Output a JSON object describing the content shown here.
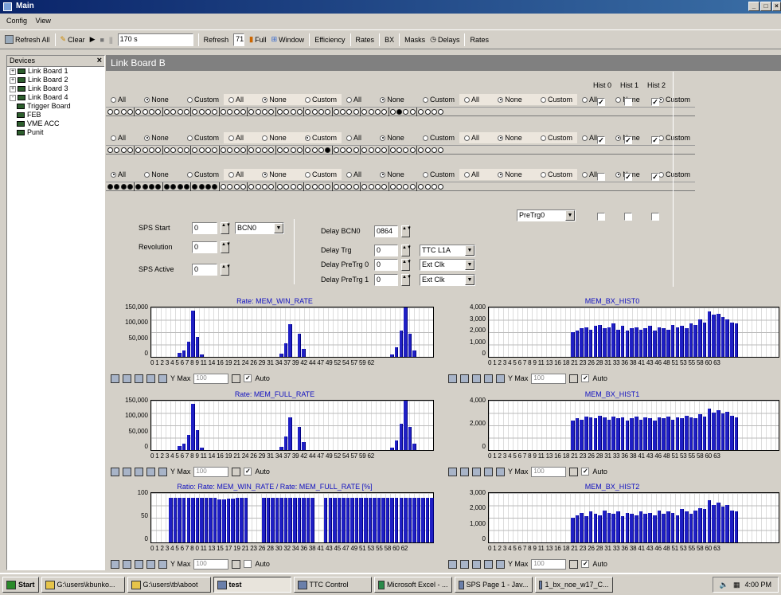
{
  "window": {
    "title": "Main",
    "controls": [
      "_",
      "□",
      "×"
    ]
  },
  "menu": [
    "Config",
    "View"
  ],
  "toolbar": {
    "refresh_all": "Refresh All",
    "clear": "Clear",
    "play": "▶",
    "stop": "■",
    "pause": "||",
    "interval_value": "170 s",
    "refresh_label": "Refresh",
    "refresh_value": "71",
    "full": "Full",
    "window_btn": "Window",
    "efficiency": "Efficiency",
    "rates": "Rates",
    "bx": "BX",
    "masks": "Masks",
    "delays": "Delays",
    "rates2": "Rates"
  },
  "devices": {
    "title": "Devices",
    "close": "×",
    "items": [
      {
        "label": "Link Board 1",
        "expander": "+"
      },
      {
        "label": "Link Board 2",
        "expander": "+"
      },
      {
        "label": "Link Board 3",
        "expander": "+"
      },
      {
        "label": "Link Board 4",
        "expander": "-"
      },
      {
        "label": "Trigger Board",
        "expander": ""
      },
      {
        "label": "FEB",
        "expander": ""
      },
      {
        "label": "VME ACC",
        "expander": ""
      },
      {
        "label": "Punit",
        "expander": ""
      }
    ]
  },
  "board": {
    "title": "Link Board B",
    "radio_labels": [
      "All",
      "None",
      "Custom"
    ],
    "rows": [
      {
        "selected": [
          "None",
          "None",
          "None",
          "None",
          "Custom"
        ],
        "on": [
          41
        ]
      },
      {
        "selected": [
          "None",
          "Custom",
          "None",
          "None",
          "None"
        ],
        "on": [
          31
        ]
      },
      {
        "selected": [
          "All",
          "None",
          "None",
          "None",
          "None"
        ],
        "on": [
          0,
          1,
          2,
          3,
          4,
          5,
          6,
          7,
          8,
          9,
          10,
          11,
          12,
          13,
          14,
          15
        ]
      }
    ],
    "hist_headers": [
      "Hist 0",
      "Hist 1",
      "Hist 2"
    ],
    "hist_checks": [
      [
        true,
        false,
        true
      ],
      [
        true,
        true,
        true
      ],
      [
        false,
        true,
        true
      ],
      [
        false,
        false,
        false
      ]
    ],
    "pretrg_select": "PreTrg0",
    "sps_start_label": "SPS Start",
    "sps_start_value": "0",
    "sps_start_select": "BCN0",
    "revolution_label": "Revolution",
    "revolution_value": "0",
    "sps_active_label": "SPS Active",
    "sps_active_value": "0",
    "delay_bcn0_label": "Delay BCN0",
    "delay_bcn0_value": "0864",
    "delay_trg_label": "Delay Trg",
    "delay_trg_value": "0",
    "delay_trg_select": "TTC L1A",
    "delay_pretrg0_label": "Delay PreTrg 0",
    "delay_pretrg0_value": "0",
    "delay_pretrg0_select": "Ext Clk",
    "delay_pretrg1_label": "Delay PreTrg 1",
    "delay_pretrg1_value": "0",
    "delay_pretrg1_select": "Ext Clk"
  },
  "chart_toolbar": {
    "ymax_label": "Y Max",
    "ymax_value": "100",
    "auto_label": "Auto"
  },
  "chart_data": [
    {
      "type": "bar",
      "title": "Rate: MEM_WIN_RATE",
      "xlabel_text": "0 1 2 3 4 5 6 7 8 9  11  14 16  19 21  24 26  29 31  34  37 39  42 44  47 49  52 54  57 59  62",
      "ylim": [
        0,
        150000
      ],
      "yticks": [
        "150,000",
        "100,000",
        "50,000",
        "0"
      ],
      "x": [
        0,
        1,
        2,
        3,
        4,
        5,
        6,
        7,
        8,
        9,
        10,
        11,
        12,
        13,
        14,
        15,
        16,
        17,
        18,
        19,
        20,
        21,
        22,
        23,
        24,
        25,
        26,
        27,
        28,
        29,
        30,
        31,
        32,
        33,
        34,
        35,
        36,
        37,
        38,
        39,
        40,
        41,
        42,
        43,
        44,
        45,
        46,
        47,
        48,
        49,
        50,
        51,
        52,
        53,
        54,
        55,
        56,
        57,
        58,
        59,
        60,
        61,
        62,
        63
      ],
      "values": [
        0,
        0,
        0,
        0,
        0,
        0,
        0,
        0,
        0,
        0,
        0,
        0,
        0,
        0,
        0,
        0,
        0,
        0,
        0,
        0,
        0,
        0,
        0,
        0,
        0,
        0,
        0,
        0,
        0,
        0,
        0,
        0,
        0,
        0,
        0,
        0,
        0,
        0,
        0,
        0,
        0,
        0,
        0,
        0,
        0,
        0,
        0,
        0,
        0,
        0,
        0,
        0,
        0,
        0,
        0,
        0,
        0,
        0,
        0,
        0,
        0,
        0,
        0,
        0
      ],
      "peaks": [
        [
          6,
          12000
        ],
        [
          7,
          20000
        ],
        [
          8,
          45000
        ],
        [
          9,
          140000
        ],
        [
          10,
          60000
        ],
        [
          11,
          8000
        ],
        [
          29,
          10000
        ],
        [
          30,
          40000
        ],
        [
          31,
          100000
        ],
        [
          33,
          70000
        ],
        [
          34,
          25000
        ],
        [
          54,
          8000
        ],
        [
          55,
          30000
        ],
        [
          56,
          80000
        ],
        [
          57,
          150000
        ],
        [
          58,
          70000
        ],
        [
          59,
          20000
        ]
      ]
    },
    {
      "type": "bar",
      "title": "MEM_BX_HIST0",
      "xlabel_text": "0 1 2 3 4 5 6 7 8 9  11 13  16 18  21 23  26 28  31 33  36 38  41 43  46 48  51 53 55  58 60  63",
      "ylim": [
        0,
        4000
      ],
      "yticks": [
        "4,000",
        "3,000",
        "2,000",
        "1,000",
        "0"
      ],
      "start": 18,
      "values": [
        2000,
        2100,
        2300,
        2400,
        2200,
        2500,
        2600,
        2300,
        2400,
        2700,
        2200,
        2500,
        2100,
        2300,
        2400,
        2200,
        2300,
        2500,
        2100,
        2400,
        2300,
        2200,
        2600,
        2400,
        2500,
        2300,
        2700,
        2600,
        3000,
        2800,
        3700,
        3400,
        3500,
        3200,
        3000,
        2800,
        2700
      ]
    },
    {
      "type": "bar",
      "title": "Rate: MEM_FULL_RATE",
      "xlabel_text": "0 1 2 3 4 5 6 7 8 9  11  14 16  19 21  24 26  29 31  34  37 39  42 44  47 49  52 54  57 59  62",
      "ylim": [
        0,
        150000
      ],
      "yticks": [
        "150,000",
        "100,000",
        "50,000",
        "0"
      ],
      "peaks": [
        [
          6,
          12000
        ],
        [
          7,
          20000
        ],
        [
          8,
          45000
        ],
        [
          9,
          140000
        ],
        [
          10,
          60000
        ],
        [
          11,
          8000
        ],
        [
          29,
          10000
        ],
        [
          30,
          40000
        ],
        [
          31,
          100000
        ],
        [
          33,
          70000
        ],
        [
          34,
          25000
        ],
        [
          54,
          8000
        ],
        [
          55,
          30000
        ],
        [
          56,
          80000
        ],
        [
          57,
          150000
        ],
        [
          58,
          70000
        ],
        [
          59,
          20000
        ]
      ]
    },
    {
      "type": "bar",
      "title": "MEM_BX_HIST1",
      "xlabel_text": "0 1 2 3 4 5 6 7 8 9  11 13  16 18  21 23  26 28  31 33  36 38  41 43  46 48  51 53 55  58 60  63",
      "ylim": [
        0,
        5000
      ],
      "yticks": [
        "4,000",
        "2,000",
        "0"
      ],
      "start": 18,
      "values": [
        3000,
        3200,
        3100,
        3400,
        3300,
        3200,
        3500,
        3300,
        3100,
        3400,
        3200,
        3300,
        3000,
        3200,
        3400,
        3100,
        3300,
        3200,
        3000,
        3300,
        3200,
        3400,
        3100,
        3300,
        3200,
        3500,
        3300,
        3200,
        3600,
        3400,
        4200,
        3800,
        4000,
        3700,
        3900,
        3500,
        3300
      ]
    },
    {
      "type": "bar",
      "title": "Ratio: Rate: MEM_WIN_RATE / Rate: MEM_FULL_RATE [%]",
      "xlabel_text": "0 1 2 3 4 5 6 7 8 0  11 13 15 17 19 21 23  26 28 30 32 34 36 38  41 43 45 47 49 51 53 55  58 60 62",
      "ylim": [
        0,
        110
      ],
      "yticks": [
        "100",
        "50",
        "0"
      ],
      "ratio": true
    },
    {
      "type": "bar",
      "title": "MEM_BX_HIST2",
      "xlabel_text": "0 1 2 3 4 5 6 7 8 9  11 13  16 18  21 23  26 28  31 33  36 38  41 43  46 48  51 53 55  58 60  63",
      "ylim": [
        0,
        4000
      ],
      "yticks": [
        "3,000",
        "2,000",
        "1,000",
        "0"
      ],
      "start": 18,
      "values": [
        2000,
        2200,
        2400,
        2100,
        2500,
        2300,
        2200,
        2600,
        2400,
        2300,
        2500,
        2100,
        2400,
        2300,
        2200,
        2500,
        2300,
        2400,
        2200,
        2600,
        2300,
        2500,
        2400,
        2200,
        2700,
        2500,
        2300,
        2600,
        2800,
        2700,
        3400,
        3000,
        3200,
        2900,
        3000,
        2600,
        2500
      ]
    }
  ],
  "taskbar": {
    "start": "Start",
    "items": [
      "G:\\users\\kbunko...",
      "G:\\users\\tb\\aboot",
      "test",
      "TTC Control",
      "Microsoft Excel - ...",
      "SPS Page 1 - Jav...",
      "1_bx_noe_w17_C..."
    ],
    "clock": "4:00 PM"
  }
}
